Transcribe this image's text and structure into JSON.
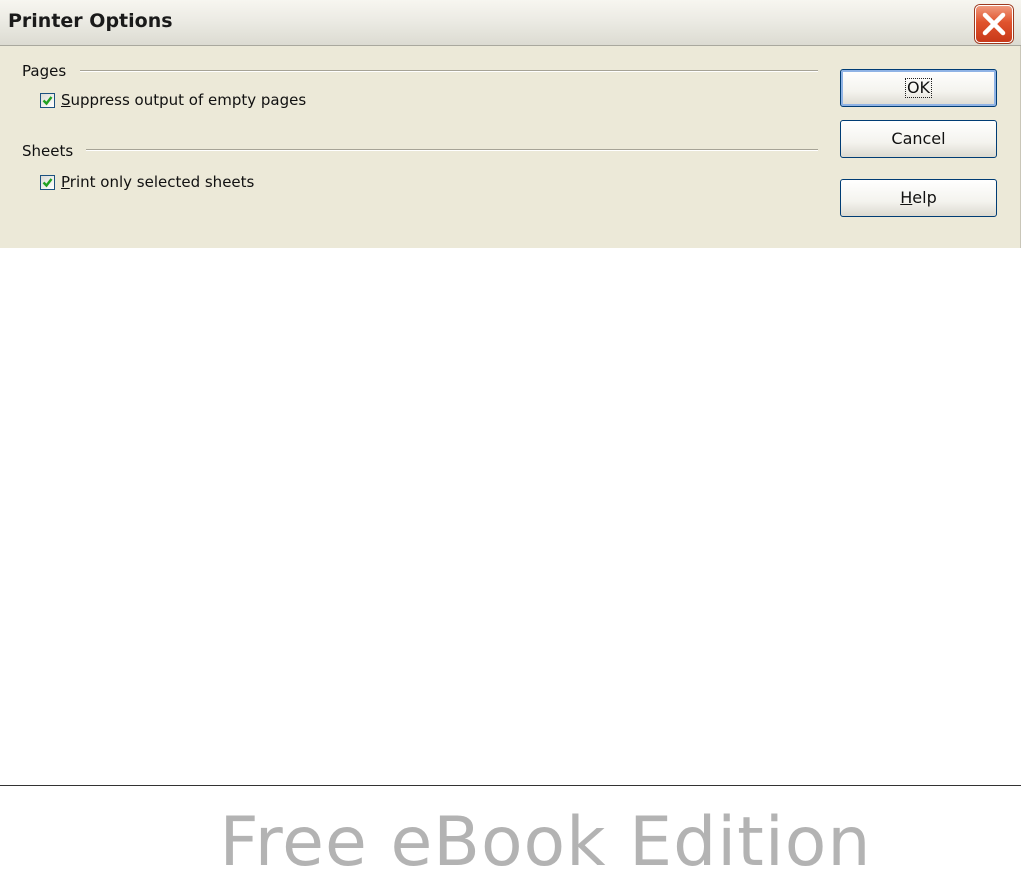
{
  "dialog": {
    "title": "Printer Options",
    "close_icon": "close-icon",
    "pages_group": {
      "label": "Pages",
      "option": {
        "label": "Suppress output of empty pages",
        "mnemonic": "S",
        "rest": "uppress output of empty pages",
        "checked": true
      }
    },
    "sheets_group": {
      "label": "Sheets",
      "option": {
        "label": "Print only selected sheets",
        "mnemonic": "P",
        "rest": "rint only selected sheets",
        "checked": true
      }
    },
    "buttons": {
      "ok": "OK",
      "cancel": "Cancel",
      "help_mnemonic": "H",
      "help_rest": "elp"
    }
  },
  "footer": {
    "watermark": "Free eBook Edition"
  },
  "colors": {
    "dialog_bg": "#ECE9D8",
    "close_red": "#E0532D",
    "check_green": "#21A121",
    "watermark_gray": "#B3B3B3"
  }
}
